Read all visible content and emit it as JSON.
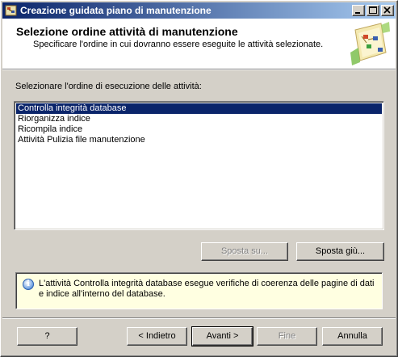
{
  "window": {
    "title": "Creazione guidata piano di manutenzione",
    "icon": "wizard-app-icon"
  },
  "header": {
    "title": "Selezione ordine attività di manutenzione",
    "subtitle": "Specificare l'ordine in cui dovranno essere eseguite le attività selezionate.",
    "graphic": "wizard-banner-graphic"
  },
  "prompt": "Selezionare l'ordine di esecuzione delle attività:",
  "tasks": [
    {
      "label": "Controlla integrità database",
      "selected": true
    },
    {
      "label": "Riorganizza indice",
      "selected": false
    },
    {
      "label": "Ricompila indice",
      "selected": false
    },
    {
      "label": "Attività Pulizia file manutenzione",
      "selected": false
    }
  ],
  "move_buttons": {
    "up_label": "Sposta su...",
    "up_enabled": false,
    "down_label": "Sposta giù...",
    "down_enabled": true
  },
  "info": {
    "icon": "info-icon",
    "text": "L'attività Controlla integrità database esegue verifiche di coerenza delle pagine di dati e indice all'interno del database."
  },
  "footer": {
    "help_label": "?",
    "back_label": "< Indietro",
    "next_label": "Avanti >",
    "finish_label": "Fine",
    "cancel_label": "Annulla"
  },
  "colors": {
    "title_gradient_start": "#0a246a",
    "title_gradient_end": "#a6caf0",
    "selection": "#0a246a",
    "info_background": "#ffffe1",
    "dialog_face": "#d4d0c8"
  }
}
